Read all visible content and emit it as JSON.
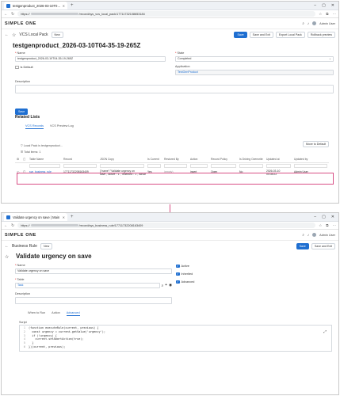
{
  "window1": {
    "tab_title": "testgenproduct_2026-03-10T04-3",
    "url_prefix": "https://",
    "url_suffix": "/record/sys_vcs_local_pack/17711732108653184",
    "user_name": "Admin User",
    "logo": "SIMPLE ONE",
    "nav_title": "VCS Local Pack",
    "new_label": "New",
    "actions": [
      "Save",
      "Save and Exit",
      "Export Local Pack",
      "Rollback preview"
    ],
    "record_title": "testgenproduct_2026-03-10T04-35-19-265Z",
    "name_label": "Name",
    "name_value": "testgenproduct_2026-03-10T04-35-19-265Z",
    "state_label": "State",
    "state_value": "Completed",
    "is_default_label": "Is Default",
    "application_label": "Application",
    "application_value": "TestGenProduct",
    "description_label": "Description",
    "save_label": "Save",
    "related_lists_title": "Related Lists",
    "subtabs": [
      "VCS Records",
      "VCS Preview Log"
    ],
    "move_default_label": "Move to Default",
    "breadcrumb": "Local Pack is testgenproduct...",
    "total_items": "Total items: 1",
    "columns": [
      "Table Name",
      "Record",
      "JSON Copy",
      "Is Current",
      "Restored By",
      "Action",
      "Record Policy",
      "Is Driving Overwrite",
      "Updated at",
      "Updated by"
    ],
    "row": {
      "table_name": "sys_business_rule",
      "record": "17711732208163409",
      "json_copy": "{\"name\":\"Validate urgency on save\",\"active\":\"1\",\"inherited\":\"1\",\"advanced\":\"1\",\"order\":\"1000\"}",
      "is_current": "Yes",
      "restored_by": "(empty)",
      "action": "insert",
      "record_policy": "Open",
      "is_driving": "No",
      "updated_at": "2026-03-10 04:35:22",
      "updated_by": "Admin User"
    }
  },
  "window2": {
    "tab_title": "Validate urgency on save | Main",
    "url_prefix": "https://",
    "url_suffix": "/record/sys_business_rule/17711732208163409",
    "user_name": "Admin User",
    "logo": "SIMPLE ONE",
    "nav_title": "Business Rule",
    "new_label": "New",
    "actions": [
      "Save",
      "Save and Exit"
    ],
    "record_title": "Validate urgency on save",
    "name_label": "Name",
    "name_value": "Validate urgency on save",
    "table_label": "Table",
    "table_value": "Task",
    "checks": [
      "Active",
      "Inherited",
      "Advanced"
    ],
    "description_label": "Description",
    "subtabs": [
      "When to Run",
      "Action",
      "Advanced"
    ],
    "script_label": "Script",
    "code_lines": [
      "(function executeRule(current, previous) {",
      "  const urgency = current.getValue('urgency');",
      "  if (!urgency) {",
      "    current.setAbortAction(true);",
      "  }",
      "})(current, previous);"
    ]
  }
}
